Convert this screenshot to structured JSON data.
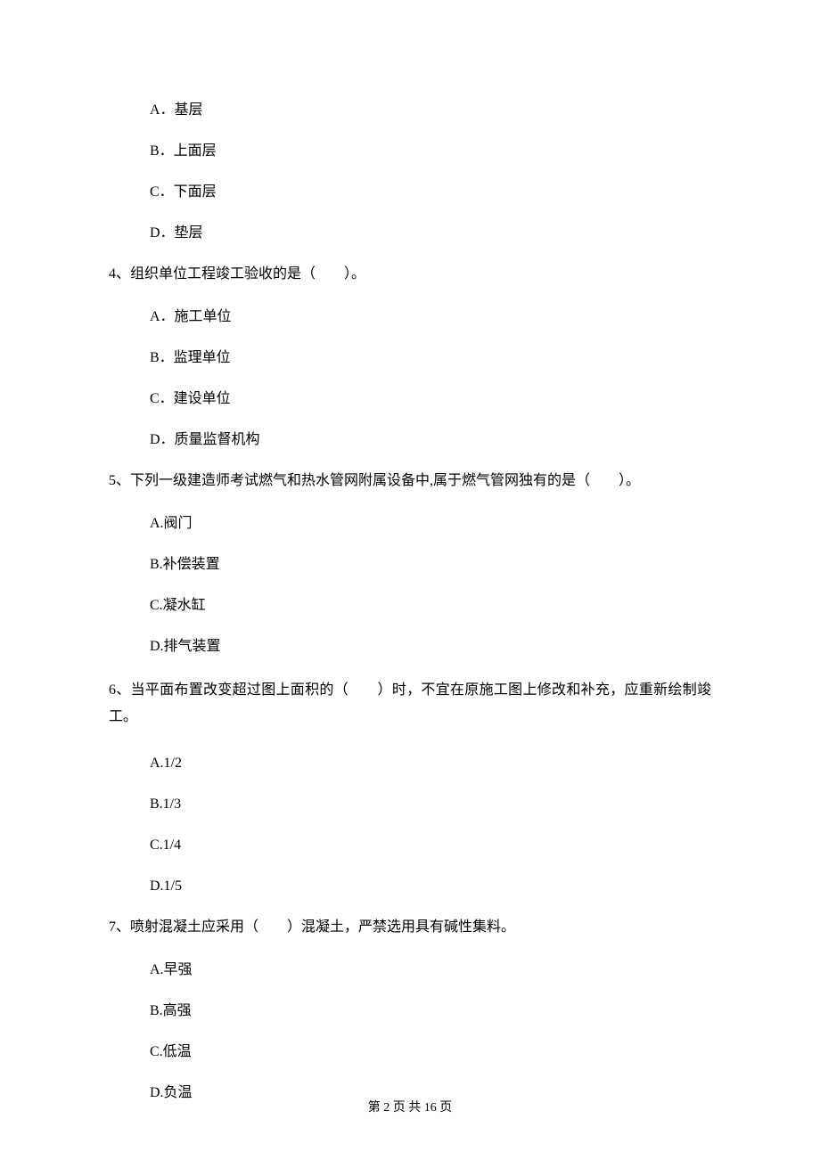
{
  "q3": {
    "opts": {
      "a": "A．基层",
      "b": "B．上面层",
      "c": "C．下面层",
      "d": "D．垫层"
    }
  },
  "q4": {
    "stem": "4、组织单位工程竣工验收的是（　　）。",
    "opts": {
      "a": "A．施工单位",
      "b": "B．监理单位",
      "c": "C．建设单位",
      "d": "D．质量监督机构"
    }
  },
  "q5": {
    "stem": "5、下列一级建造师考试燃气和热水管网附属设备中,属于燃气管网独有的是（　　）。",
    "opts": {
      "a": "A.阀门",
      "b": "B.补偿装置",
      "c": "C.凝水缸",
      "d": "D.排气装置"
    }
  },
  "q6": {
    "stem": "6、当平面布置改变超过图上面积的（　　）时，不宜在原施工图上修改和补充，应重新绘制竣工。",
    "opts": {
      "a": "A.1/2",
      "b": "B.1/3",
      "c": "C.1/4",
      "d": "D.1/5"
    }
  },
  "q7": {
    "stem": "7、喷射混凝土应采用（　　）混凝土，严禁选用具有碱性集料。",
    "opts": {
      "a": "A.早强",
      "b": "B.高强",
      "c": "C.低温",
      "d": "D.负温"
    }
  },
  "footer": "第 2 页 共 16 页"
}
